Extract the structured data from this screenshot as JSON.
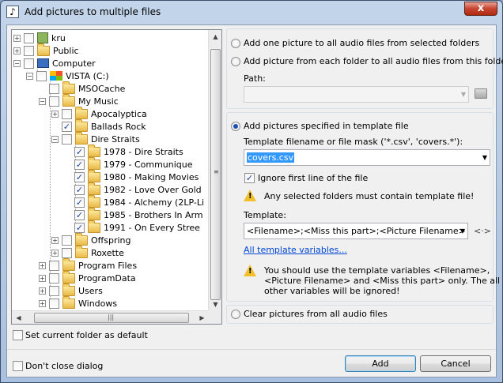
{
  "window": {
    "title": "Add pictures to multiple files",
    "close_glyph": "x"
  },
  "tree": {
    "items": [
      {
        "label": "kru",
        "icon": "user-icon",
        "expander": "+",
        "checked": false
      },
      {
        "label": "Public",
        "icon": "folder-icon",
        "expander": "+",
        "checked": false
      },
      {
        "label": "Computer",
        "icon": "computer-icon",
        "expander": "-",
        "checked": false
      },
      {
        "label": "VISTA (C:)",
        "icon": "drive-icon",
        "expander": "-",
        "checked": false
      },
      {
        "label": "MSOCache",
        "icon": "folder-icon",
        "expander": "",
        "checked": false
      },
      {
        "label": "My Music",
        "icon": "folder-icon",
        "expander": "-",
        "checked": false
      },
      {
        "label": "Apocalyptica",
        "icon": "folder-icon",
        "expander": "+",
        "checked": false
      },
      {
        "label": "Ballads Rock",
        "icon": "folder-icon",
        "expander": "",
        "checked": true
      },
      {
        "label": "Dire Straits",
        "icon": "folder-icon",
        "expander": "-",
        "checked": false
      },
      {
        "label": "1978 - Dire Straits",
        "icon": "folder-icon",
        "expander": "",
        "checked": true
      },
      {
        "label": "1979 - Communique",
        "icon": "folder-icon",
        "expander": "",
        "checked": true
      },
      {
        "label": "1980 - Making Movies",
        "icon": "folder-icon",
        "expander": "",
        "checked": true
      },
      {
        "label": "1982 - Love Over Gold",
        "icon": "folder-icon",
        "expander": "",
        "checked": true
      },
      {
        "label": "1984 - Alchemy (2LP-Li",
        "icon": "folder-icon",
        "expander": "",
        "checked": true
      },
      {
        "label": "1985 - Brothers In Arm",
        "icon": "folder-icon",
        "expander": "",
        "checked": true
      },
      {
        "label": "1991 - On Every Stree",
        "icon": "folder-icon",
        "expander": "",
        "checked": true
      },
      {
        "label": "Offspring",
        "icon": "folder-icon",
        "expander": "+",
        "checked": false
      },
      {
        "label": "Roxette",
        "icon": "folder-icon",
        "expander": "+",
        "checked": false
      },
      {
        "label": "Program Files",
        "icon": "folder-icon",
        "expander": "+",
        "checked": false
      },
      {
        "label": "ProgramData",
        "icon": "folder-icon",
        "expander": "+",
        "checked": false
      },
      {
        "label": "Users",
        "icon": "folder-icon",
        "expander": "+",
        "checked": false
      },
      {
        "label": "Windows",
        "icon": "folder-icon",
        "expander": "+",
        "checked": false
      }
    ]
  },
  "options": {
    "add_one": "Add one picture to all audio files from selected folders",
    "add_each": "Add picture from each folder to all audio files from this folder",
    "path_label": "Path:",
    "path_value": "",
    "add_template": "Add pictures specified in template file",
    "mask_label": "Template filename or file mask ('*.csv', 'covers.*'):",
    "mask_value": "covers.csv",
    "ignore_first_line": "Ignore first line of the file",
    "warning_folders": "Any selected folders must contain template file!",
    "template_label": "Template:",
    "template_value": "<Filename>;<Miss this part>;<Picture Filename>",
    "arrows_glyph": "<·>",
    "all_vars_link": "All template variables...",
    "warning_vars_1": "You should use the template variables <Filename>,",
    "warning_vars_2": "<Picture Filename> and <Miss this part> only. The all",
    "warning_vars_3": "other variables will be ignored!",
    "clear_pictures": "Clear pictures from all audio files"
  },
  "footer": {
    "set_default": "Set current folder as default",
    "dont_close": "Don't close dialog",
    "add_button": "Add",
    "cancel_button": "Cancel"
  },
  "colors": {
    "accent": "#3399ff",
    "link": "#0046d5",
    "warning": "#f2c02b"
  }
}
